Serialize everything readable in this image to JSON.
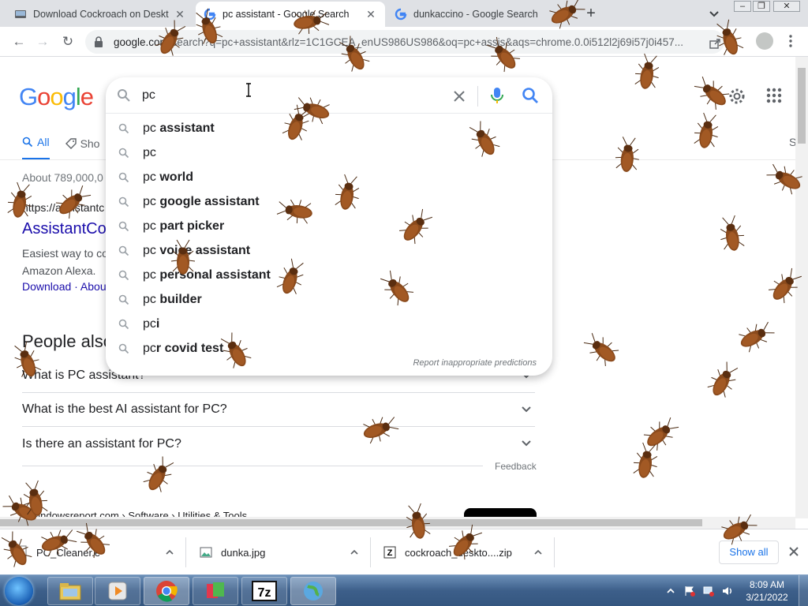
{
  "browser": {
    "tabs": [
      {
        "title": "Download Cockroach on Desktop",
        "active": false
      },
      {
        "title": "pc assistant - Google Search",
        "active": true
      },
      {
        "title": "dunkaccino - Google Search",
        "active": false
      }
    ],
    "url_host": "google.com",
    "url_rest": "/search?q=pc+assistant&rlz=1C1GCEA_enUS986US986&oq=pc+assis&aqs=chrome.0.0i512l2j69i57j0i457..."
  },
  "search": {
    "query": "pc",
    "suggestions": [
      {
        "prefix": "pc",
        "rest": " assistant"
      },
      {
        "prefix": "pc",
        "rest": ""
      },
      {
        "prefix": "pc",
        "rest": " world"
      },
      {
        "prefix": "pc",
        "rest": " google assistant"
      },
      {
        "prefix": "pc",
        "rest": " part picker"
      },
      {
        "prefix": "pc",
        "rest": " voice assistant"
      },
      {
        "prefix": "pc",
        "rest": " personal assistant"
      },
      {
        "prefix": "pc",
        "rest": " builder"
      },
      {
        "prefix": "pc",
        "rest": "i"
      },
      {
        "prefix": "pc",
        "rest": "r covid test"
      }
    ],
    "report_text": "Report inappropriate predictions"
  },
  "nav": {
    "all": "All",
    "shopping": "Sho",
    "tools_partial": "S"
  },
  "results": {
    "stats": "About 789,000,0",
    "cite": "https://assistantc",
    "title": "AssistantCo",
    "snippet": "Easiest way to co\nAmazon Alexa.",
    "sitelinks": "Download · Abou",
    "paa_title": "People also",
    "paa": [
      "What is PC assistant?",
      "What is the best AI assistant for PC?",
      "Is there an assistant for PC?"
    ],
    "feedback": "Feedback",
    "next_cite": "://windowsreport.com › Software › Utilities & Tools"
  },
  "downloads": [
    {
      "name": "PC_Cleaner.e"
    },
    {
      "name": "dunka.jpg"
    },
    {
      "name": "cockroach_deskto....zip"
    }
  ],
  "shelf": {
    "show_all": "Show all"
  },
  "taskbar": {
    "time": "8:09 AM",
    "date": "3/21/2022"
  },
  "colors": {
    "google_blue": "#4285F4",
    "google_red": "#EA4335",
    "google_yellow": "#FBBC05",
    "google_green": "#34A853",
    "link": "#1a0dab",
    "accent": "#1a73e8"
  }
}
